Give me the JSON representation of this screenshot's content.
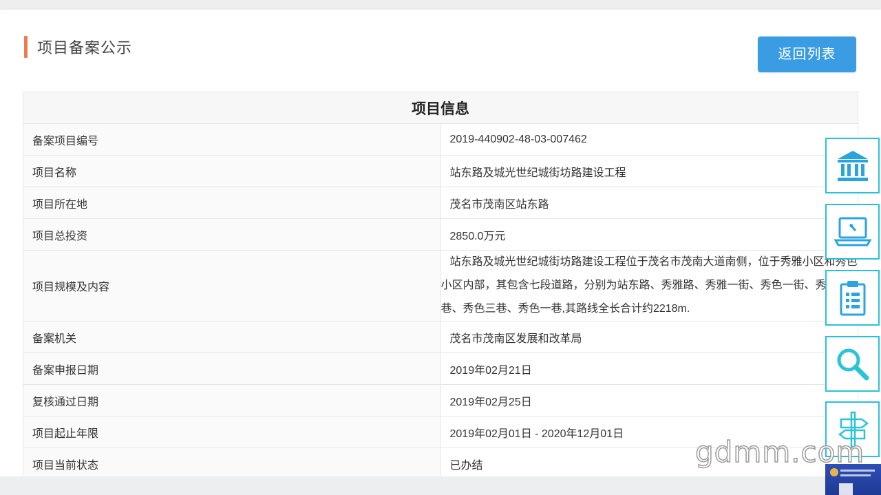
{
  "page": {
    "title": "项目备案公示",
    "back_button": "返回列表"
  },
  "table": {
    "heading": "项目信息",
    "rows": [
      {
        "label": "备案项目编号",
        "value": "2019-440902-48-03-007462"
      },
      {
        "label": "项目名称",
        "value": "站东路及城光世纪城街坊路建设工程"
      },
      {
        "label": "项目所在地",
        "value": "茂名市茂南区站东路"
      },
      {
        "label": "项目总投资",
        "value": "2850.0万元"
      },
      {
        "label": "项目规模及内容",
        "value": "站东路及城光世纪城街坊路建设工程位于茂名市茂南大道南侧，位于秀雅小区和秀色小区内部，其包含七段道路，分别为站东路、秀雅路、秀雅一街、秀色一街、秀色二巷、秀色三巷、秀色一巷,其路线全长合计约2218m."
      },
      {
        "label": "备案机关",
        "value": "茂名市茂南区发展和改革局"
      },
      {
        "label": "备案申报日期",
        "value": "2019年02月21日"
      },
      {
        "label": "复核通过日期",
        "value": "2019年02月25日"
      },
      {
        "label": "项目起止年限",
        "value": "2019年02月01日 - 2020年12月01日"
      },
      {
        "label": "项目当前状态",
        "value": "已办结"
      }
    ]
  },
  "side_nav": {
    "items": [
      {
        "icon": "government-building-icon"
      },
      {
        "icon": "laptop-icon"
      },
      {
        "icon": "clipboard-icon"
      },
      {
        "icon": "search-icon"
      },
      {
        "icon": "signpost-icon"
      }
    ],
    "accent_color": "#29c1d8"
  },
  "watermark": "gdmm.com",
  "colors": {
    "title_bar": "#f07a4f",
    "button": "#3a9ce3"
  }
}
